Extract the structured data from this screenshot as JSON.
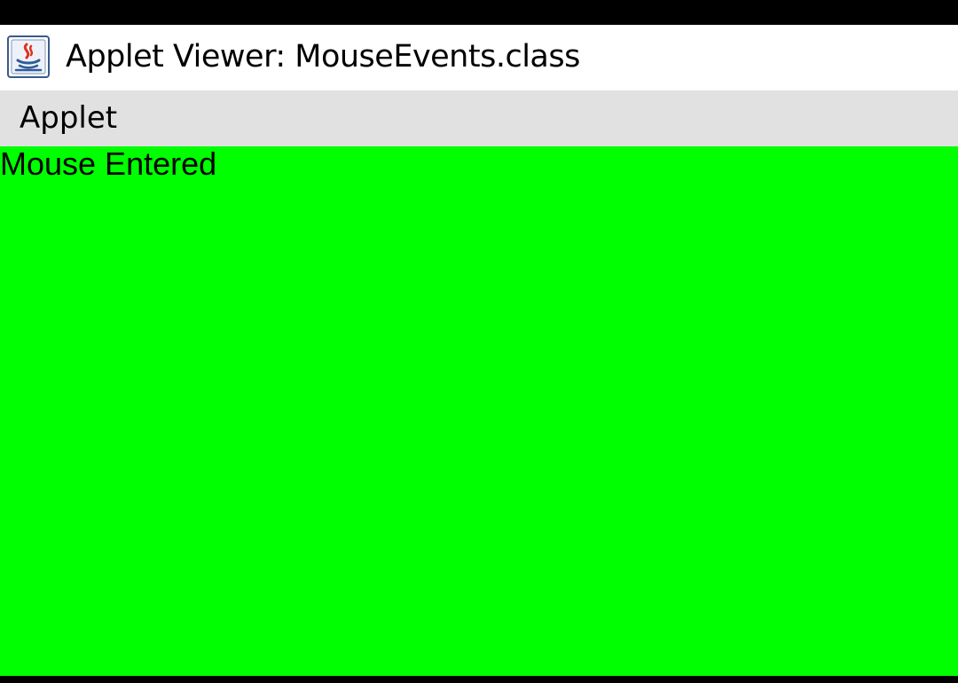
{
  "window": {
    "title": "Applet Viewer: MouseEvents.class",
    "icon": "java-icon"
  },
  "menubar": {
    "items": [
      {
        "label": "Applet"
      }
    ]
  },
  "applet": {
    "background_color": "#00ff00",
    "message": "Mouse Entered"
  }
}
